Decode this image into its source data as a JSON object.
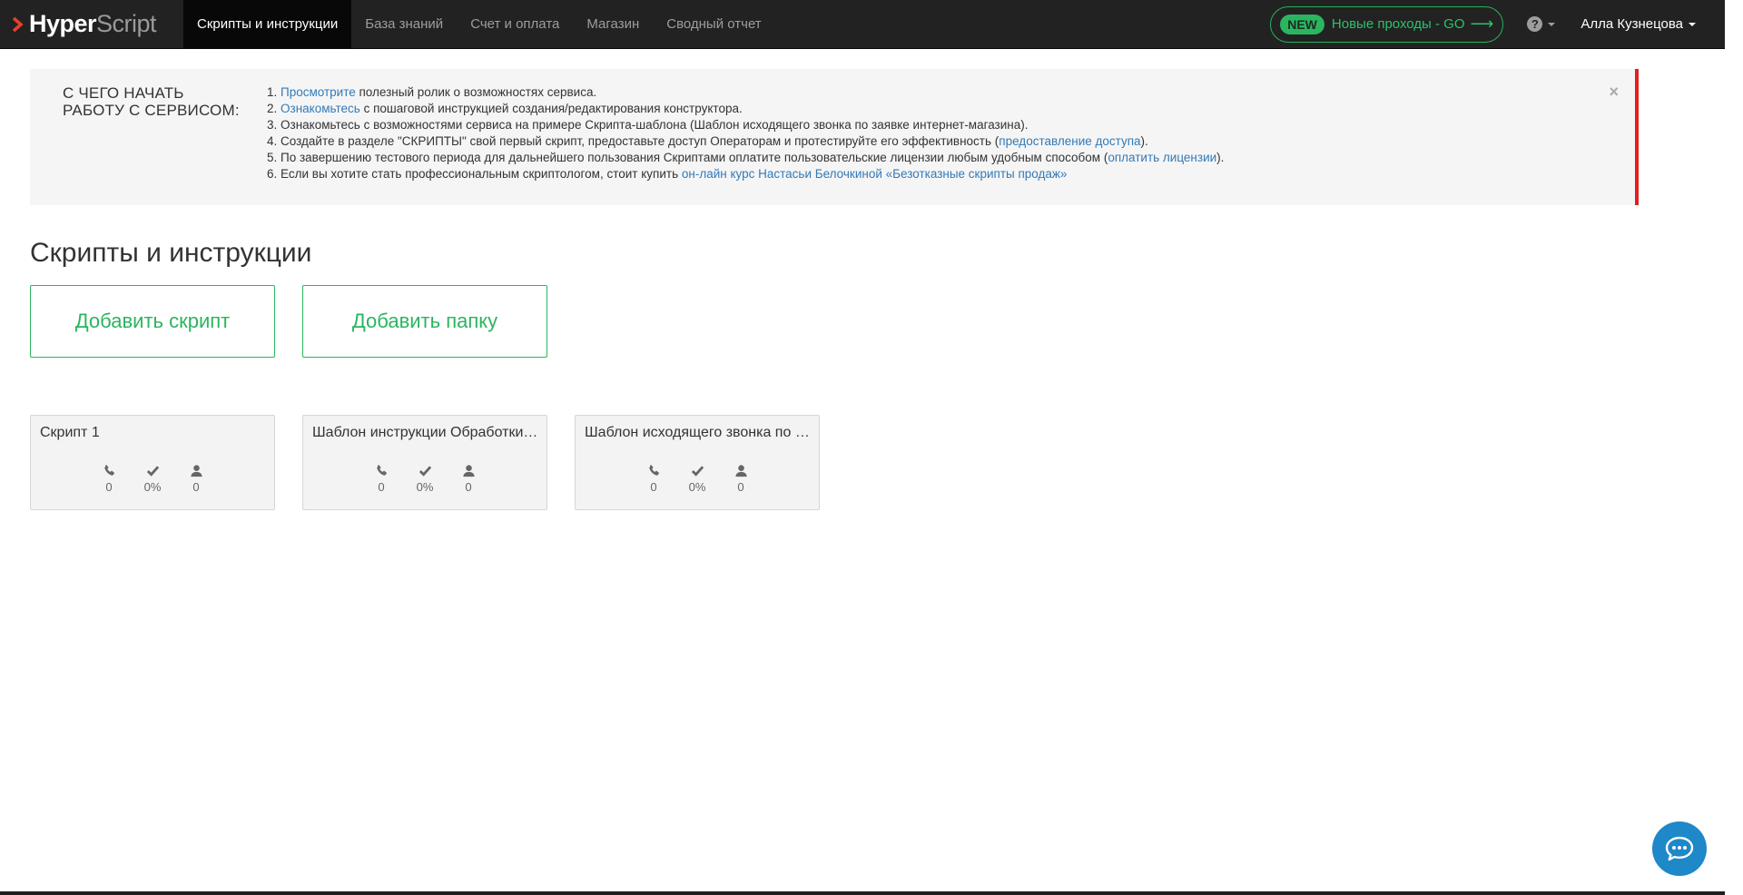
{
  "brand": {
    "hyper": "Hyper",
    "script": "Script"
  },
  "nav": {
    "items": [
      {
        "label": "Скрипты и инструкции",
        "active": true
      },
      {
        "label": "База знаний"
      },
      {
        "label": "Счет и оплата"
      },
      {
        "label": "Магазин"
      },
      {
        "label": "Сводный отчет"
      }
    ],
    "new_badge": "NEW",
    "new_text": "Новые проходы - GO",
    "help": "?",
    "user": "Алла Кузнецова"
  },
  "info": {
    "title_line1": "С ЧЕГО НАЧАТЬ",
    "title_line2": "РАБОТУ С СЕРВИСОМ:",
    "items": [
      {
        "num": "1. ",
        "link": "Просмотрите",
        "text": " полезный ролик о возможностях сервиса."
      },
      {
        "num": "2. ",
        "link": "Ознакомьтесь",
        "text": " с пошаговой инструкцией создания/редактирования конструктора."
      },
      {
        "num": "3. ",
        "text": "Ознакомьтесь с возможностями сервиса на примере Скрипта-шаблона (Шаблон исходящего звонка по заявке интернет-магазина)."
      },
      {
        "num": "4. ",
        "text": "Создайте в разделе \"СКРИПТЫ\" свой первый скрипт, предоставьте доступ Операторам и протестируйте его эффективность (",
        "link": "предоставление доступа",
        "tail": ")."
      },
      {
        "num": "5. ",
        "text": "По завершению тестового периода для дальнейшего пользования Скриптами оплатите пользовательские лицензии любым удобным способом (",
        "link": "оплатить лицензии",
        "tail": ")."
      },
      {
        "num": "6. ",
        "text": "Если вы хотите стать профессиональным скриптологом, стоит купить ",
        "link": "он-лайн курс Настасьи Белочкиной «Безотказные скрипты продаж»"
      }
    ],
    "close": "×"
  },
  "main": {
    "title": "Скрипты и инструкции",
    "add_script": "Добавить скрипт",
    "add_folder": "Добавить папку"
  },
  "cards": [
    {
      "title": "Скрипт 1",
      "calls": "0",
      "success": "0%",
      "users": "0"
    },
    {
      "title": "Шаблон инструкции Обработки входящей заявки",
      "calls": "0",
      "success": "0%",
      "users": "0"
    },
    {
      "title": "Шаблон исходящего звонка по заявке интернет-магазина",
      "calls": "0",
      "success": "0%",
      "users": "0"
    }
  ],
  "colors": {
    "accent": "#2bb55f",
    "link": "#337ab7",
    "alert": "#e02020",
    "chat": "#1e88c9"
  }
}
